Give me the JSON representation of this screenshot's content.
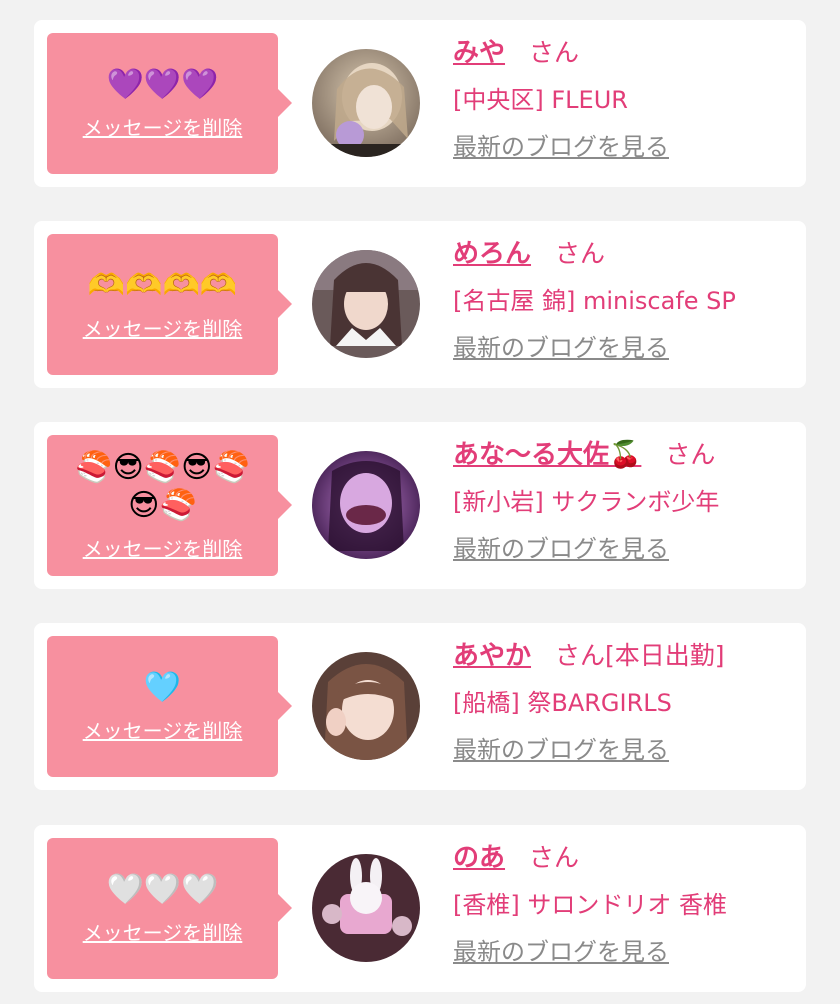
{
  "messages": [
    {
      "message": "💜💜💜",
      "delete_label": "メッセージを削除",
      "name": "みや",
      "honorific": "さん",
      "extra": "",
      "shop": "[中央区] FLEUR",
      "blog_link": "最新のブログを見る",
      "avatar_colors": [
        "#c9b49a",
        "#6e5a4a"
      ]
    },
    {
      "message": "🫶🫶🫶🫶",
      "delete_label": "メッセージを削除",
      "name": "めろん",
      "honorific": "さん",
      "extra": "",
      "shop": "[名古屋 錦] miniscafe SP",
      "blog_link": "最新のブログを見る",
      "avatar_colors": [
        "#e8c8b8",
        "#3a2a2a"
      ]
    },
    {
      "message": "🍣😎🍣😎🍣😎🍣",
      "delete_label": "メッセージを削除",
      "name": "あな〜る大佐🍒",
      "honorific": "さん",
      "extra": "",
      "shop": "[新小岩] サクランボ少年",
      "blog_link": "最新のブログを見る",
      "avatar_colors": [
        "#b070c8",
        "#3a1848"
      ]
    },
    {
      "message": "🩵",
      "delete_label": "メッセージを削除",
      "name": "あやか",
      "honorific": "さん",
      "extra": "[本日出勤]",
      "shop": "[船橋] 祭BARGIRLS",
      "blog_link": "最新のブログを見る",
      "avatar_colors": [
        "#f0d8cc",
        "#5a3a30"
      ]
    },
    {
      "message": "🤍🤍🤍",
      "delete_label": "メッセージを削除",
      "name": "のあ",
      "honorific": "さん",
      "extra": "",
      "shop": "[香椎] サロンドリオ 香椎",
      "blog_link": "最新のブログを見る",
      "avatar_colors": [
        "#e8b8d8",
        "#4a2a38"
      ]
    }
  ]
}
